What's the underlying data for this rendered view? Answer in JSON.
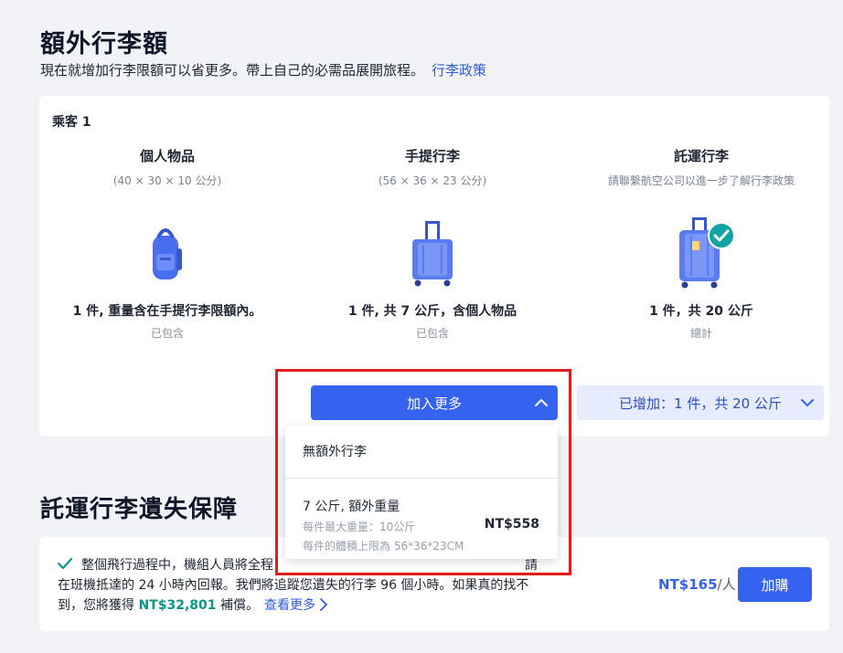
{
  "header": {
    "title": "額外行李額",
    "subtitle": "現在就增加行李限額可以省更多。帶上自己的必需品展開旅程。",
    "policy_link": "行李政策"
  },
  "baggage": {
    "passenger_label": "乘客 1",
    "columns": [
      {
        "heading": "個人物品",
        "dimensions": "(40 × 30 × 10 公分)",
        "description": "1 件, 重量含在手提行李限額內。",
        "note": "已包含",
        "icon": "backpack-icon"
      },
      {
        "heading": "手提行李",
        "dimensions": "(56 × 36 × 23 公分)",
        "description": "1 件, 共 7 公斤，含個人物品",
        "note": "已包含",
        "icon": "carry-on-suitcase-icon"
      },
      {
        "heading": "託運行李",
        "dimensions": "請聯繫航空公司以進一步了解行李政策",
        "description": "1 件，共 20 公斤",
        "note": "總計",
        "icon": "checked-suitcase-icon"
      }
    ],
    "add_more_label": "加入更多",
    "added_label": "已增加：1 件，共 20 公斤",
    "dropdown": {
      "no_extra_label": "無額外行李",
      "option": {
        "title": "7 公斤, 額外重量",
        "max_weight": "每件最大重量：10公斤",
        "max_size": "每件的體積上限為 56*36*23CM",
        "price": "NT$558"
      }
    }
  },
  "insurance": {
    "title": "託運行李遺失保障",
    "line1": "整個飛行過程中，機組人員將全程",
    "line1_end": "請",
    "line2": "在班機抵達的 24 小時內回報。我們將追蹤您遺失的行李 96 個小時。如果真的找不",
    "line3_pre": "到，您將獲得 ",
    "amount": "NT$32,801",
    "line3_post": " 補償。",
    "more_link": "查看更多",
    "price": "NT$165",
    "price_unit": "/人",
    "buy_label": "加購"
  },
  "colors": {
    "primary": "#3662f0",
    "teal": "#0d9488",
    "highlight": "#e21b1b"
  }
}
